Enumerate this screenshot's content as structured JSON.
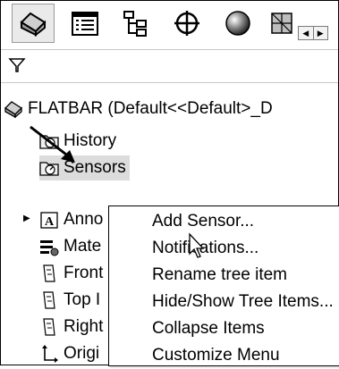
{
  "tabs": [
    {
      "name": "feature-manager",
      "icon": "feature-manager-tab-icon",
      "active": true
    },
    {
      "name": "property-manager",
      "icon": "property-manager-tab-icon"
    },
    {
      "name": "configuration-manager",
      "icon": "configuration-manager-tab-icon"
    },
    {
      "name": "dimxpert-manager",
      "icon": "dimxpert-crosshair-tab-icon"
    },
    {
      "name": "display-manager",
      "icon": "display-sphere-tab-icon"
    }
  ],
  "filter": {
    "icon": "filter-funnel-icon"
  },
  "tree": {
    "root_label": "FLATBAR  (Default<<Default>_D",
    "items": [
      {
        "label": "History",
        "icon": "history-folder-icon"
      },
      {
        "label": "Sensors",
        "icon": "sensors-folder-icon"
      },
      {
        "label": "Anno",
        "icon": "annotations-icon"
      },
      {
        "label": "Mate",
        "icon": "material-icon"
      },
      {
        "label": "Front",
        "icon": "plane-icon"
      },
      {
        "label": "Top I",
        "icon": "plane-icon"
      },
      {
        "label": "Right",
        "icon": "plane-icon"
      },
      {
        "label": "Origi",
        "icon": "origin-icon"
      }
    ]
  },
  "context_menu": {
    "items": [
      {
        "label": "Add Sensor..."
      },
      {
        "label": "Notifications..."
      },
      {
        "label": "Rename tree item"
      },
      {
        "label": "Hide/Show Tree Items..."
      },
      {
        "label": "Collapse Items"
      },
      {
        "label": "Customize Menu"
      }
    ]
  },
  "colors": {
    "selection": "#dcdcdc",
    "menu_border": "#000000"
  }
}
